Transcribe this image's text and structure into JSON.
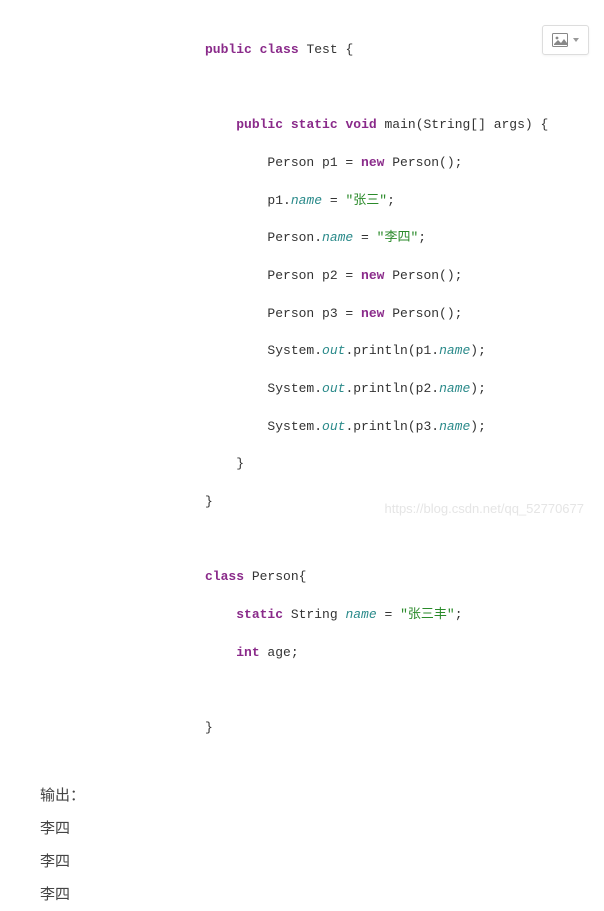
{
  "code": {
    "l1": [
      {
        "t": "public",
        "c": "kw"
      },
      {
        "t": " ",
        "c": "plain"
      },
      {
        "t": "class",
        "c": "kw"
      },
      {
        "t": " Test {",
        "c": "plain"
      }
    ],
    "l2": [
      {
        "t": "",
        "c": "plain"
      }
    ],
    "l3": [
      {
        "t": "    ",
        "c": "plain"
      },
      {
        "t": "public",
        "c": "kw"
      },
      {
        "t": " ",
        "c": "plain"
      },
      {
        "t": "static",
        "c": "kw"
      },
      {
        "t": " ",
        "c": "plain"
      },
      {
        "t": "void",
        "c": "kw"
      },
      {
        "t": " main(String[] args) {",
        "c": "plain"
      }
    ],
    "l4": [
      {
        "t": "        Person p1 = ",
        "c": "plain"
      },
      {
        "t": "new",
        "c": "kw"
      },
      {
        "t": " Person();",
        "c": "plain"
      }
    ],
    "l5": [
      {
        "t": "        p1.",
        "c": "plain"
      },
      {
        "t": "name",
        "c": "em"
      },
      {
        "t": " = ",
        "c": "plain"
      },
      {
        "t": "\"张三\"",
        "c": "str"
      },
      {
        "t": ";",
        "c": "plain"
      }
    ],
    "l6": [
      {
        "t": "        Person.",
        "c": "plain"
      },
      {
        "t": "name",
        "c": "em"
      },
      {
        "t": " = ",
        "c": "plain"
      },
      {
        "t": "\"李四\"",
        "c": "str"
      },
      {
        "t": ";",
        "c": "plain"
      }
    ],
    "l7": [
      {
        "t": "        Person p2 = ",
        "c": "plain"
      },
      {
        "t": "new",
        "c": "kw"
      },
      {
        "t": " Person();",
        "c": "plain"
      }
    ],
    "l8": [
      {
        "t": "        Person p3 = ",
        "c": "plain"
      },
      {
        "t": "new",
        "c": "kw"
      },
      {
        "t": " Person();",
        "c": "plain"
      }
    ],
    "l9": [
      {
        "t": "        System.",
        "c": "plain"
      },
      {
        "t": "out",
        "c": "em"
      },
      {
        "t": ".println(p1.",
        "c": "plain"
      },
      {
        "t": "name",
        "c": "em"
      },
      {
        "t": ");",
        "c": "plain"
      }
    ],
    "l10": [
      {
        "t": "        System.",
        "c": "plain"
      },
      {
        "t": "out",
        "c": "em"
      },
      {
        "t": ".println(p2.",
        "c": "plain"
      },
      {
        "t": "name",
        "c": "em"
      },
      {
        "t": ");",
        "c": "plain"
      }
    ],
    "l11": [
      {
        "t": "        System.",
        "c": "plain"
      },
      {
        "t": "out",
        "c": "em"
      },
      {
        "t": ".println(p3.",
        "c": "plain"
      },
      {
        "t": "name",
        "c": "em"
      },
      {
        "t": ");",
        "c": "plain"
      }
    ],
    "l12": [
      {
        "t": "    }",
        "c": "plain"
      }
    ],
    "l13": [
      {
        "t": "}",
        "c": "plain"
      }
    ],
    "l14": [
      {
        "t": "",
        "c": "plain"
      }
    ],
    "l15": [
      {
        "t": "class",
        "c": "kw"
      },
      {
        "t": " Person{",
        "c": "plain"
      }
    ],
    "l16": [
      {
        "t": "    ",
        "c": "plain"
      },
      {
        "t": "static",
        "c": "kw"
      },
      {
        "t": " String ",
        "c": "plain"
      },
      {
        "t": "name",
        "c": "em"
      },
      {
        "t": " = ",
        "c": "plain"
      },
      {
        "t": "\"张三丰\"",
        "c": "str"
      },
      {
        "t": ";",
        "c": "plain"
      }
    ],
    "l17": [
      {
        "t": "    ",
        "c": "plain"
      },
      {
        "t": "int",
        "c": "kw"
      },
      {
        "t": " age;",
        "c": "plain"
      }
    ],
    "l18": [
      {
        "t": "",
        "c": "plain"
      }
    ],
    "l19": [
      {
        "t": "}",
        "c": "plain"
      }
    ]
  },
  "output": {
    "label": "输出：",
    "line1": "李四",
    "line2": "李四",
    "line3": "李四"
  },
  "watermark": "https://blog.csdn.net/qq_52770677",
  "icons": {
    "image_button": "image-icon"
  }
}
